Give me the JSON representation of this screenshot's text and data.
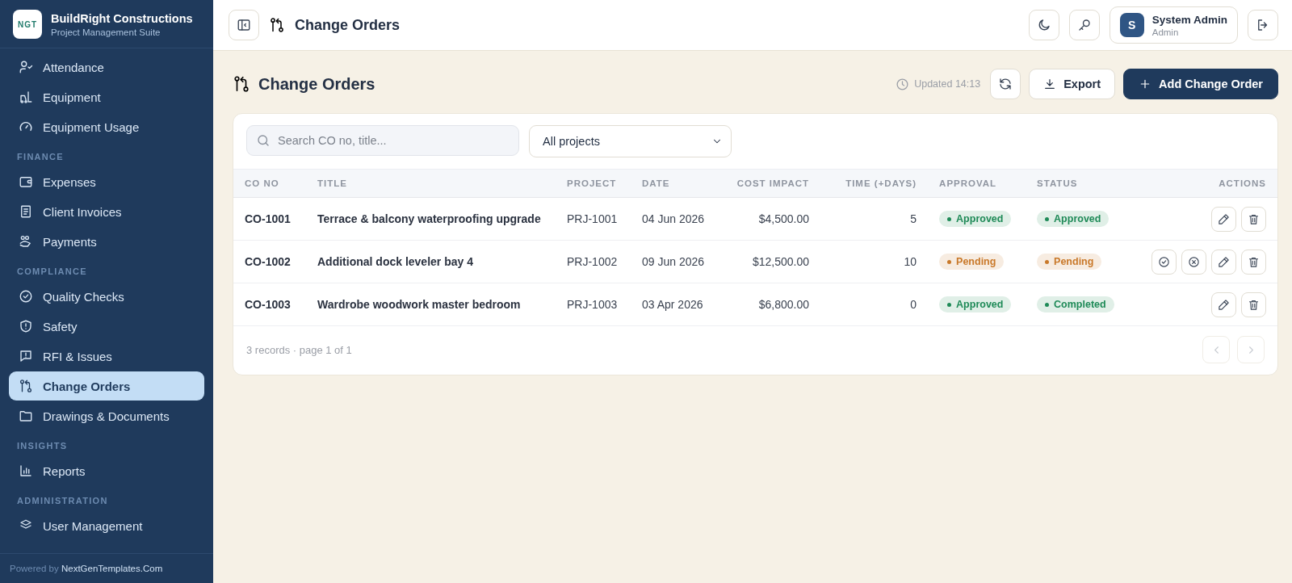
{
  "sidebar": {
    "brand": {
      "logo_text": "NGT",
      "name": "BuildRight Constructions",
      "tagline": "Project Management Suite"
    },
    "sections": [
      {
        "items": [
          {
            "label": "Attendance",
            "selected": false
          },
          {
            "label": "Equipment",
            "selected": false
          },
          {
            "label": "Equipment Usage",
            "selected": false
          }
        ]
      },
      {
        "heading": "FINANCE",
        "items": [
          {
            "label": "Expenses",
            "selected": false
          },
          {
            "label": "Client Invoices",
            "selected": false
          },
          {
            "label": "Payments",
            "selected": false
          }
        ]
      },
      {
        "heading": "COMPLIANCE",
        "items": [
          {
            "label": "Quality Checks",
            "selected": false
          },
          {
            "label": "Safety",
            "selected": false
          },
          {
            "label": "RFI & Issues",
            "selected": false
          },
          {
            "label": "Change Orders",
            "selected": true
          },
          {
            "label": "Drawings & Documents",
            "selected": false
          }
        ]
      },
      {
        "heading": "INSIGHTS",
        "items": [
          {
            "label": "Reports",
            "selected": false
          }
        ]
      },
      {
        "heading": "ADMINISTRATION",
        "items": [
          {
            "label": "User Management",
            "selected": false
          }
        ]
      }
    ],
    "footer": {
      "prefix": "Powered by",
      "link": "NextGenTemplates.Com"
    }
  },
  "topbar": {
    "title": "Change Orders",
    "user": {
      "initial": "S",
      "name": "System Admin",
      "role": "Admin"
    }
  },
  "page": {
    "title": "Change Orders",
    "updated": "Updated 14:13",
    "export_label": "Export",
    "add_label": "Add Change Order"
  },
  "filters": {
    "search": {
      "placeholder": "Search CO no, title..."
    },
    "project": {
      "value": "All projects"
    }
  },
  "table": {
    "columns": [
      "CO NO",
      "TITLE",
      "PROJECT",
      "DATE",
      "COST IMPACT",
      "TIME (+DAYS)",
      "APPROVAL",
      "STATUS",
      "ACTIONS"
    ],
    "rows": [
      {
        "co_no": "CO-1001",
        "title": "Terrace & balcony waterproofing upgrade",
        "project": "PRJ-1001",
        "date": "04 Jun 2026",
        "cost": "$4,500.00",
        "days": "5",
        "approval": {
          "label": "Approved",
          "color": "#1e8a57"
        },
        "status": {
          "label": "Approved",
          "color": "#1e8a57"
        },
        "actions": [
          {
            "kind": "edit"
          },
          {
            "kind": "delete"
          }
        ]
      },
      {
        "co_no": "CO-1002",
        "title": "Additional dock leveler bay 4",
        "project": "PRJ-1002",
        "date": "09 Jun 2026",
        "cost": "$12,500.00",
        "days": "10",
        "approval": {
          "label": "Pending",
          "color": "#c9792a"
        },
        "status": {
          "label": "Pending",
          "color": "#c9792a"
        },
        "actions": [
          {
            "kind": "approve"
          },
          {
            "kind": "reject"
          },
          {
            "kind": "edit"
          },
          {
            "kind": "delete"
          }
        ]
      },
      {
        "co_no": "CO-1003",
        "title": "Wardrobe woodwork master bedroom",
        "project": "PRJ-1003",
        "date": "03 Apr 2026",
        "cost": "$6,800.00",
        "days": "0",
        "approval": {
          "label": "Approved",
          "color": "#1e8a57"
        },
        "status": {
          "label": "Completed",
          "color": "#1e8a57"
        },
        "actions": [
          {
            "kind": "edit"
          },
          {
            "kind": "delete"
          }
        ]
      }
    ],
    "footer": "3 records · page 1 of 1",
    "pagination": {
      "prev_disabled": true,
      "next_disabled": true
    }
  }
}
